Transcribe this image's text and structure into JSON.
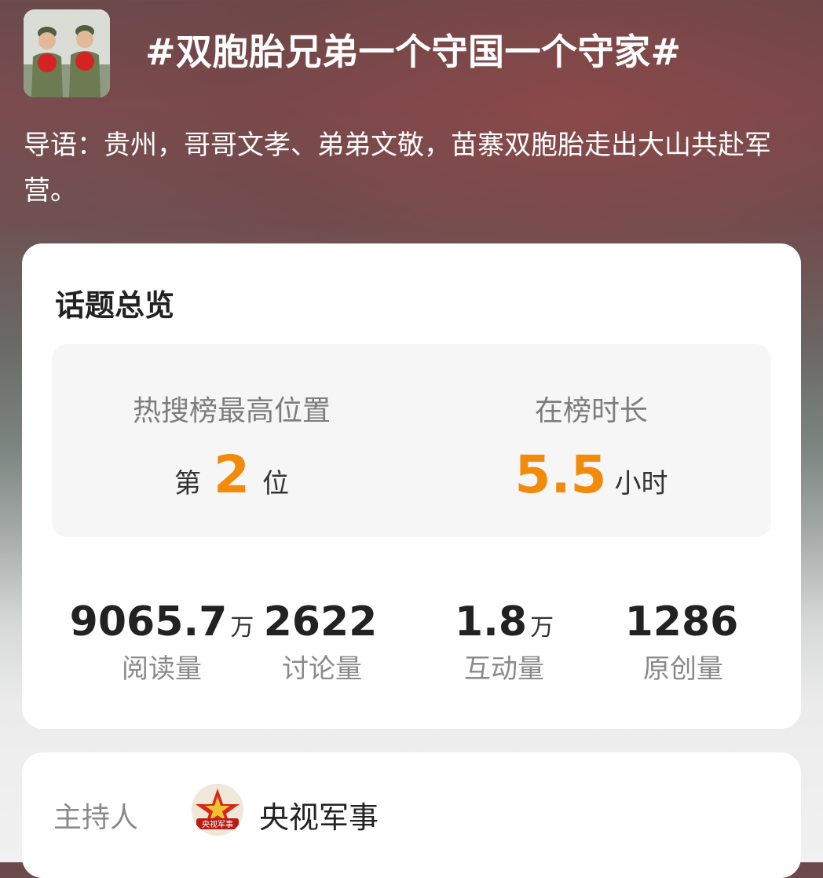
{
  "topic": {
    "title": "#双胞胎兄弟一个守国一个守家#",
    "guide": "导语：贵州，哥哥文孝、弟弟文敬，苗寨双胞胎走出大山共赴军营。"
  },
  "overview": {
    "title": "话题总览",
    "peak_rank": {
      "label": "热搜榜最高位置",
      "prefix": "第",
      "value": "2",
      "suffix": "位"
    },
    "duration": {
      "label": "在榜时长",
      "value": "5.5",
      "unit": "小时"
    },
    "stats": [
      {
        "value": "9065.7",
        "unit": "万",
        "label": "阅读量"
      },
      {
        "value": "2622",
        "unit": "",
        "label": "讨论量"
      },
      {
        "value": "1.8",
        "unit": "万",
        "label": "互动量"
      },
      {
        "value": "1286",
        "unit": "",
        "label": "原创量"
      }
    ]
  },
  "host": {
    "label": "主持人",
    "name": "央视军事",
    "badge_text": "央视军事"
  },
  "colors": {
    "accent": "#f28a0c",
    "card_bg": "#ffffff",
    "rank_box_bg": "#f6f6f6"
  }
}
